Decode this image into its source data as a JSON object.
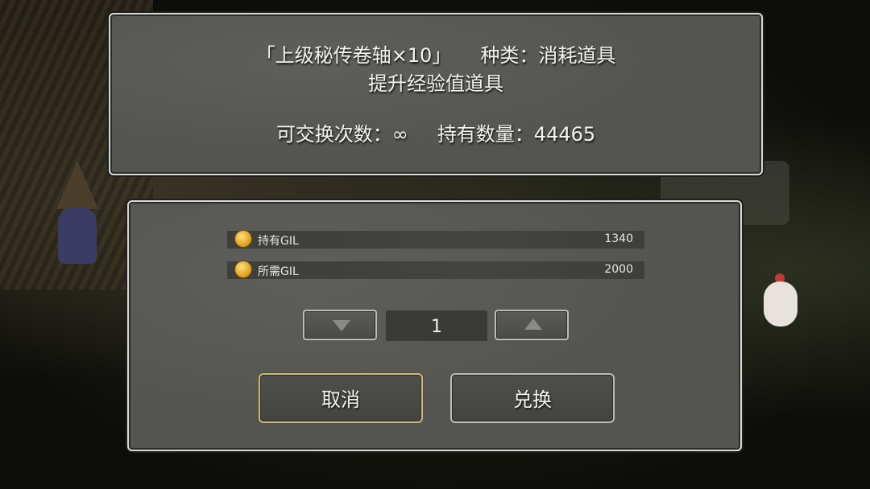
{
  "item": {
    "name": "「上级秘传卷轴×10」",
    "type_label": "种类：消耗道具",
    "description": "提升经验值道具",
    "exchange_limit": "可交换次数：∞",
    "owned": "持有数量：44465"
  },
  "gil": {
    "owned_label": "持有GIL",
    "owned_value": "1340",
    "required_label": "所需GIL",
    "required_value": "2000"
  },
  "quantity": "1",
  "buttons": {
    "cancel": "取消",
    "confirm": "兑换"
  },
  "colors": {
    "panel": "#545550",
    "border": "#d8d8d4",
    "cancel_border": "#c9b88a",
    "coin": "#d99a1e"
  },
  "icons": {
    "decrease": "down-triangle",
    "increase": "up-triangle",
    "currency": "gil-coin"
  }
}
